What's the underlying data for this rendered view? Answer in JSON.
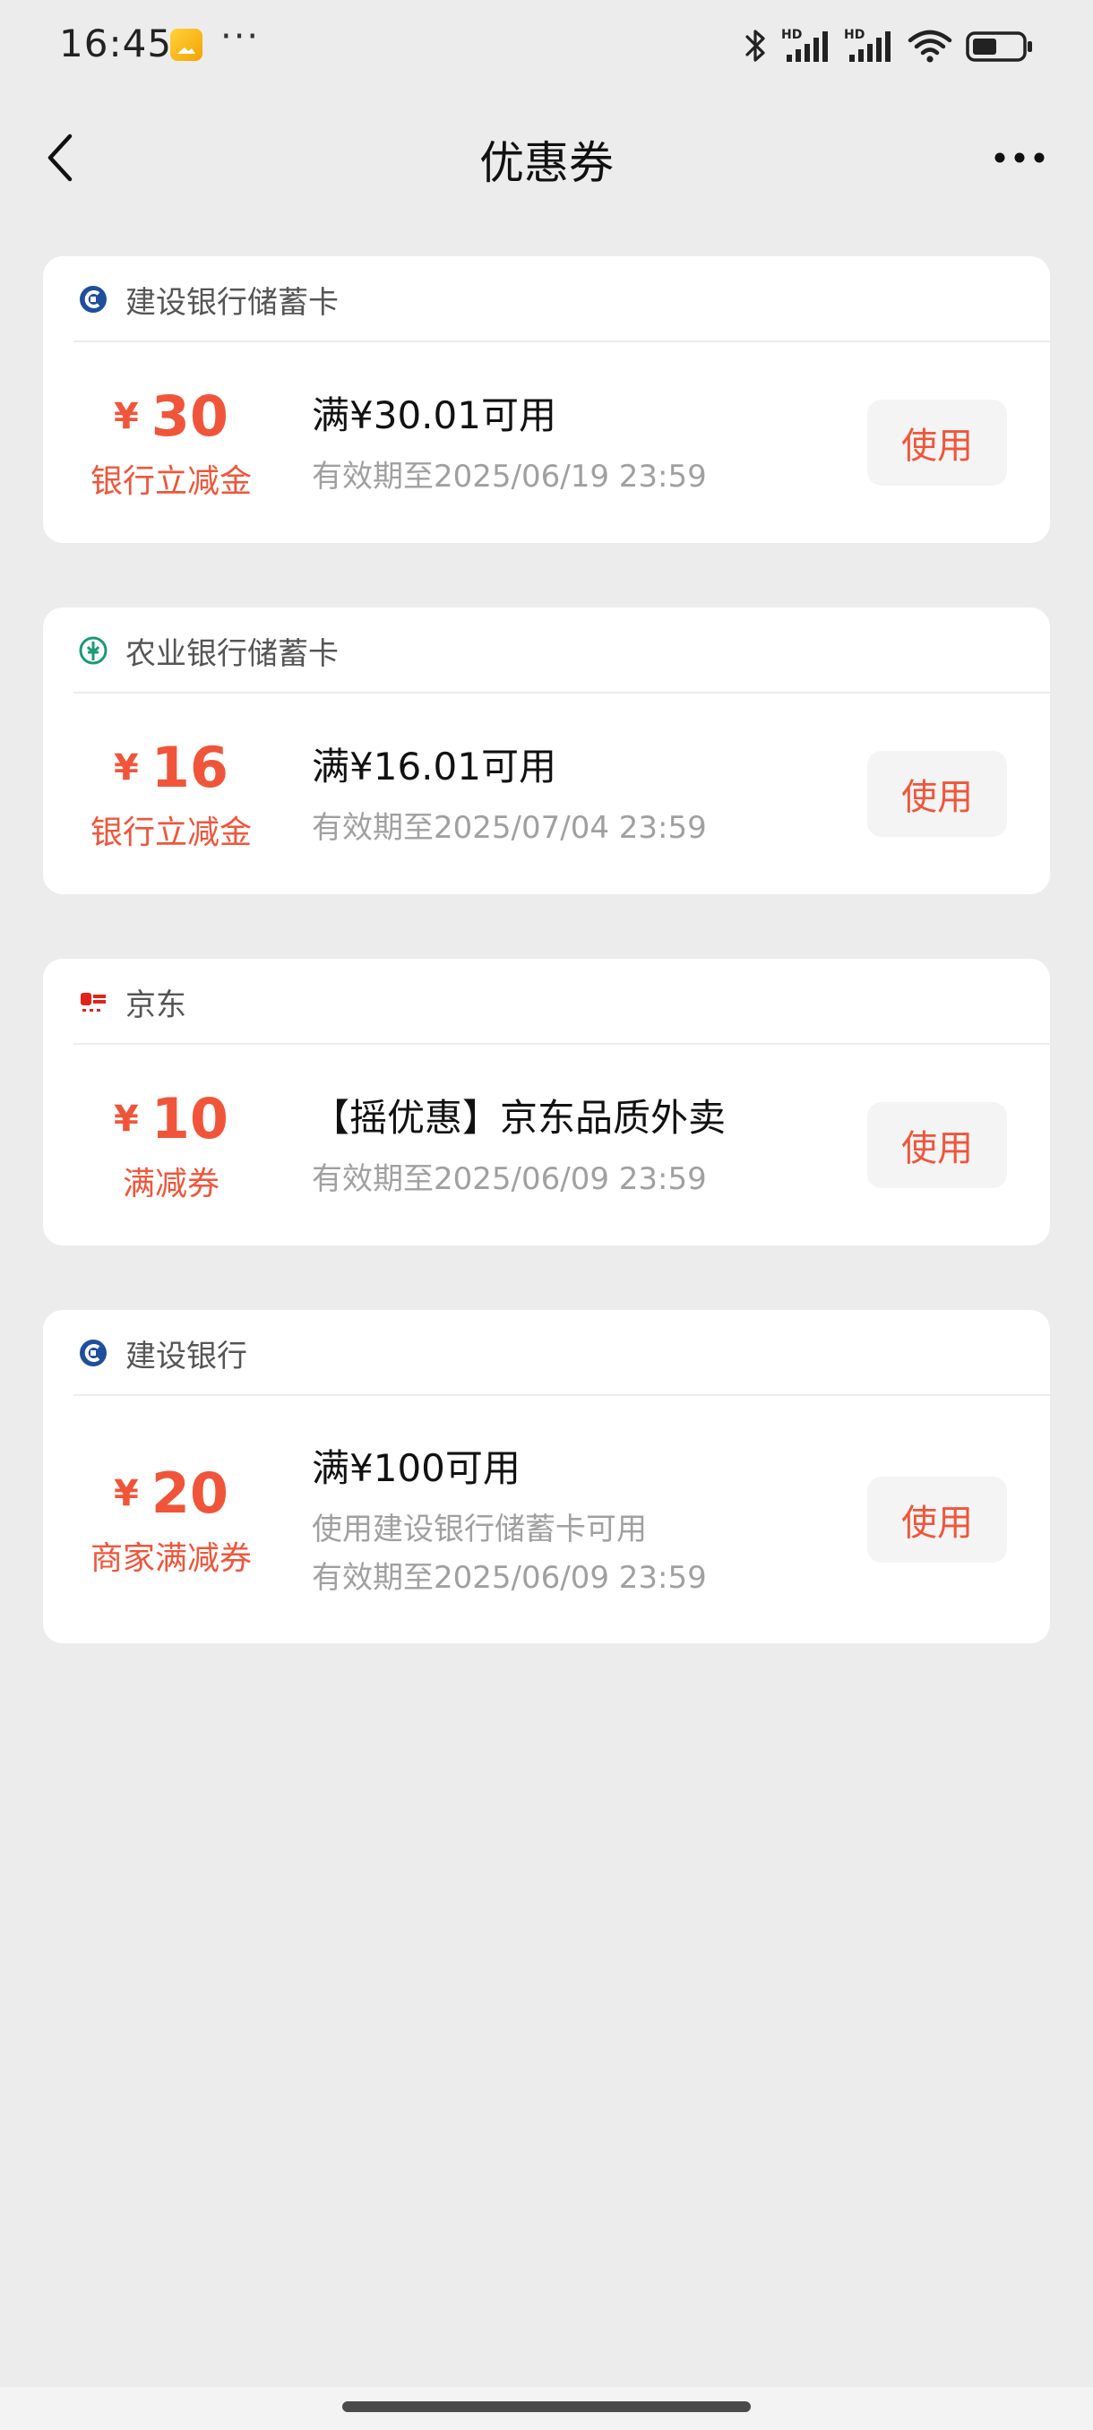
{
  "status_bar": {
    "time": "16:45",
    "more": "···",
    "icons": [
      "app-icon",
      "bluetooth-icon",
      "hd-signal-icon",
      "hd-signal-icon",
      "wifi-icon",
      "battery-icon"
    ],
    "network_label_1": "HD",
    "network_label_2": "HD"
  },
  "nav": {
    "title": "优惠券",
    "back_icon": "chevron-left-icon",
    "more_icon": "more-dots-icon"
  },
  "colors": {
    "accent": "#f0553a",
    "page_bg": "#ececec",
    "card_bg": "#ffffff",
    "muted_text": "#a0a0a0"
  },
  "coupons": [
    {
      "issuer": "建设银行储蓄卡",
      "issuer_logo": "ccb-logo-icon",
      "currency": "¥",
      "amount": "30",
      "type": "银行立减金",
      "condition": "满¥30.01可用",
      "details": [
        "有效期至2025/06/19 23:59"
      ],
      "button": "使用"
    },
    {
      "issuer": "农业银行储蓄卡",
      "issuer_logo": "abc-logo-icon",
      "currency": "¥",
      "amount": "16",
      "type": "银行立减金",
      "condition": "满¥16.01可用",
      "details": [
        "有效期至2025/07/04 23:59"
      ],
      "button": "使用"
    },
    {
      "issuer": "京东",
      "issuer_logo": "jd-logo-icon",
      "currency": "¥",
      "amount": "10",
      "type": "满减券",
      "condition": "【摇优惠】京东品质外卖",
      "details": [
        "有效期至2025/06/09 23:59"
      ],
      "button": "使用"
    },
    {
      "issuer": "建设银行",
      "issuer_logo": "ccb-logo-icon",
      "currency": "¥",
      "amount": "20",
      "type": "商家满减券",
      "condition": "满¥100可用",
      "details": [
        "使用建设银行储蓄卡可用",
        "有效期至2025/06/09 23:59"
      ],
      "button": "使用"
    }
  ]
}
